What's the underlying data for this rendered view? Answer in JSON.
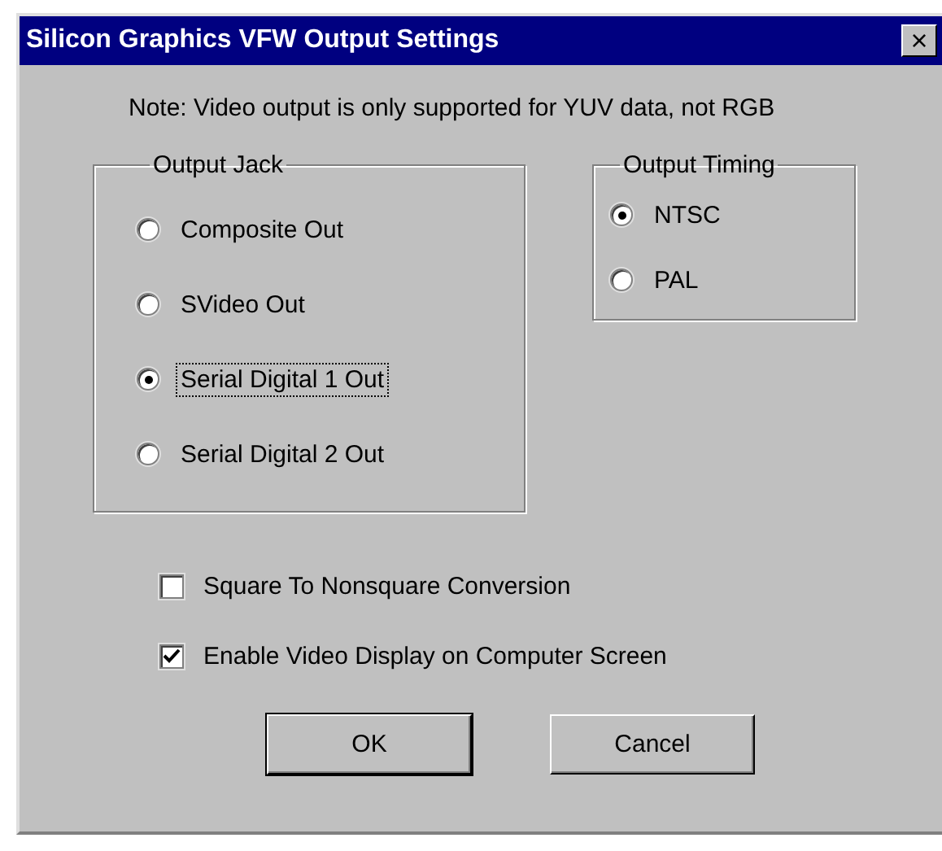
{
  "window": {
    "title": "Silicon Graphics VFW Output Settings",
    "close": "×"
  },
  "note": "Note: Video output is only supported for YUV data, not RGB",
  "groups": [
    {
      "title": "Output Jack",
      "options": [
        {
          "label": "Composite Out",
          "selected": false,
          "focused": false
        },
        {
          "label": "SVideo Out",
          "selected": false,
          "focused": false
        },
        {
          "label": "Serial Digital 1 Out",
          "selected": true,
          "focused": true
        },
        {
          "label": "Serial Digital 2 Out",
          "selected": false,
          "focused": false
        }
      ]
    },
    {
      "title": "Output Timing",
      "options": [
        {
          "label": "NTSC",
          "selected": true,
          "focused": false
        },
        {
          "label": "PAL",
          "selected": false,
          "focused": false
        }
      ]
    }
  ],
  "checkboxes": [
    {
      "label": "Square To Nonsquare Conversion",
      "checked": false
    },
    {
      "label": "Enable Video Display on Computer Screen",
      "checked": true
    }
  ],
  "buttons": [
    {
      "label": "OK",
      "default": true
    },
    {
      "label": "Cancel",
      "default": false
    }
  ]
}
